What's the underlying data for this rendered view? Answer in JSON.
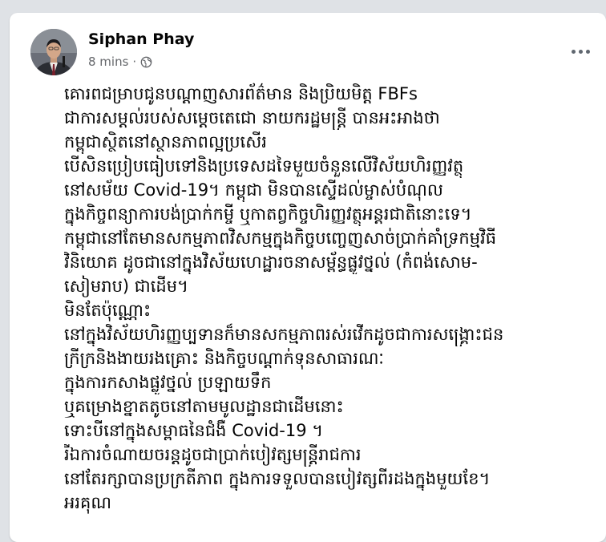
{
  "post": {
    "author_name": "Siphan Phay",
    "timestamp": "8 mins",
    "meta_separator": "·",
    "privacy_icon": "globe-icon",
    "more_icon": "more-horizontal-icon",
    "lines": [
      "គោរពជម្រាបជូនបណ្ដាញសារព័ត៌មាន និងប្រិយមិត្ត FBFs",
      "ជាការសម្ដល់របស់សម្ដេចតេជោ នាយករដ្ឋមន្ត្រី បានអះអាងថា",
      "កម្ពុជាស្ថិតនៅស្ថានភាពល្អប្រសើរ",
      "បើសិនប្រៀបធៀបទៅនិងប្រទេសដទៃមួយចំនួនលើវិស័យហិរញ្ញវត្ថុ",
      "នៅសម័យ Covid-19។ កម្ពុជា មិនបានស្ទើដល់ម្ចាស់បំណុល",
      "ក្នុងកិច្ចពន្យាការបង់ប្រាក់កម្ចី ឬកាតព្វកិច្ចហិរញ្ញវត្ថុអន្តរជាតិនោះទេ។",
      "កម្ពុជានៅតែមានសកម្មភាពវិសកម្មក្នុងកិច្ចបញ្ចេញសាច់ប្រាក់គាំទ្រកម្មវិធី",
      "វិនិយោគ ដូចជានៅក្នុងវិស័យហេដ្ឋារចនាសម្ព័ន្ធផ្លូវថ្នល់ (កំពង់សោម-",
      "សៀមរាប) ជាដើម។",
      "មិនតែប៉ុណ្ណោះ",
      "នៅក្នុងវិស័យហិរញ្ញប្បទានក៏មានសកម្មភាពរស់រវើកដូចជាការសង្គ្រោះជន",
      "ក្រីក្រនិងងាយរងគ្រោះ និងកិច្ចបណ្ដាក់ទុនសាធារណៈ",
      "ក្នុងការកសាងផ្លូវថ្នល់ ប្រឡាយទឹក",
      "ឬគម្រោងខ្នាតតូចនៅតាមមូលដ្ឋានជាដើមនោះ",
      "ទោះបីនៅក្នុងសម្ពាធនៃជំងឺ Covid-19 ។",
      "រីឯការចំណាយចរន្តដូចជាប្រាក់បៀវត្សមន្ត្រីរាជការ",
      "នៅតែរក្សាបានប្រក្រតីភាព ក្នុងការទទួលបានបៀវត្សពីរដងក្នុងមួយខែ។",
      "អរគុណ"
    ]
  }
}
